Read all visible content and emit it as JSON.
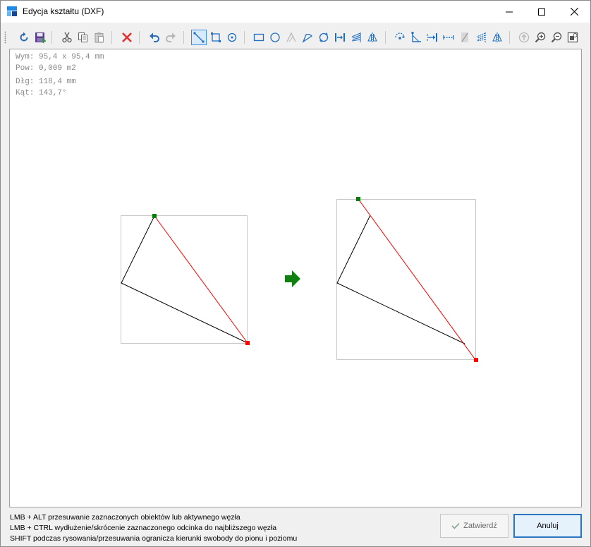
{
  "window": {
    "title": "Edycja kształtu (DXF)"
  },
  "toolbar": {
    "icons": [
      "refresh-icon",
      "save-icon",
      "cut-icon",
      "copy-icon",
      "paste-icon",
      "delete-icon",
      "undo-icon",
      "redo-icon",
      "select-segment-icon",
      "select-rectangle-icon",
      "select-circle-icon",
      "rectangle-icon",
      "circle-icon",
      "polyline-icon",
      "arc-icon",
      "rotate-icon",
      "fit-width-icon",
      "hatch-icon",
      "mirror-icon",
      "rotate-node-icon",
      "angle-icon",
      "dimension-icon",
      "measure-icon",
      "trim-icon",
      "hatch2-icon",
      "mirror2-icon",
      "up-icon",
      "zoom-in-icon",
      "zoom-out-icon",
      "zoom-fit-icon"
    ]
  },
  "canvas_info": {
    "dimensions": "Wym: 95,4 x 95,4 mm",
    "area": "Pow: 0,009 m2",
    "length": "Dłg: 118,4 mm",
    "angle": "Kąt: 143,7°"
  },
  "colors": {
    "selected_segment": "#ff0000",
    "shape_line": "#000000",
    "bounding_box": "#c8c8c8",
    "start_node": "#008000",
    "end_node": "#ff0000",
    "arrow": "#108010"
  },
  "hints": {
    "line1": "LMB + ALT przesuwanie zaznaczonych obiektów lub aktywnego węzła",
    "line2": "LMB + CTRL wydłużenie/skrócenie zaznaczonego odcinka do najbliższego węzła",
    "line3": "SHIFT podczas rysowania/przesuwania ogranicza kierunki swobody do pionu i poziomu"
  },
  "buttons": {
    "confirm": "Zatwierdź",
    "cancel": "Anuluj"
  }
}
